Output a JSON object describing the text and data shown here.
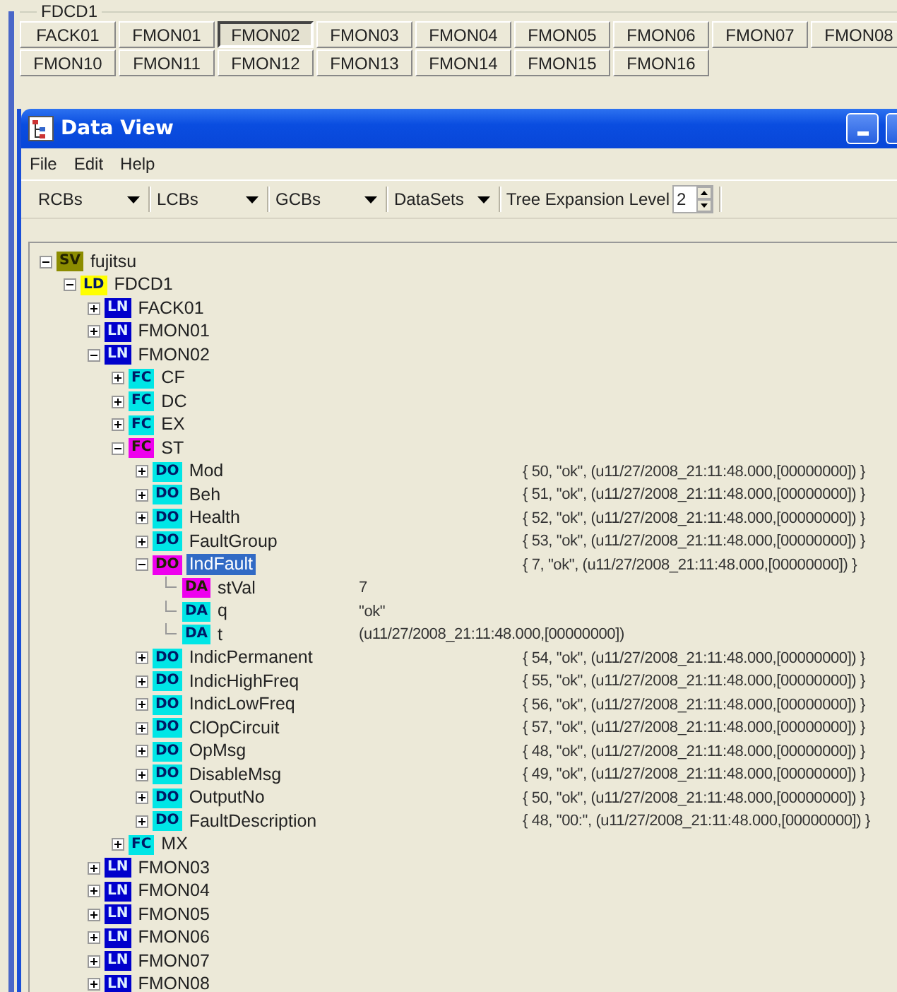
{
  "group": {
    "title": "FDCD1",
    "rows": [
      [
        {
          "label": "FACK01",
          "selected": false
        },
        {
          "label": "FMON01",
          "selected": false
        },
        {
          "label": "FMON02",
          "selected": true
        },
        {
          "label": "FMON03",
          "selected": false
        },
        {
          "label": "FMON04",
          "selected": false
        },
        {
          "label": "FMON05",
          "selected": false
        },
        {
          "label": "FMON06",
          "selected": false
        },
        {
          "label": "FMON07",
          "selected": false
        },
        {
          "label": "FMON08",
          "selected": false
        }
      ],
      [
        {
          "label": "FMON10",
          "selected": false
        },
        {
          "label": "FMON11",
          "selected": false
        },
        {
          "label": "FMON12",
          "selected": false
        },
        {
          "label": "FMON13",
          "selected": false
        },
        {
          "label": "FMON14",
          "selected": false
        },
        {
          "label": "FMON15",
          "selected": false
        },
        {
          "label": "FMON16",
          "selected": false
        }
      ]
    ]
  },
  "window": {
    "title": "Data View"
  },
  "menu": [
    "File",
    "Edit",
    "Help"
  ],
  "toolbar": {
    "dropdowns": [
      "RCBs",
      "LCBs",
      "GCBs",
      "DataSets"
    ],
    "level_label": "Tree Expansion Level",
    "level_value": "2"
  },
  "tree": [
    {
      "tag": "SV",
      "color": "#8c8c00",
      "label": "fujitsu",
      "expanded": true,
      "selected": false,
      "children": [
        {
          "tag": "LD",
          "color": "#ffff00",
          "label": "FDCD1",
          "expanded": true,
          "selected": false,
          "children": [
            {
              "tag": "LN",
              "color": "#0000cc",
              "label": "FACK01",
              "expanded": false,
              "selected": false
            },
            {
              "tag": "LN",
              "color": "#0000cc",
              "label": "FMON01",
              "expanded": false,
              "selected": false
            },
            {
              "tag": "LN",
              "color": "#0000cc",
              "label": "FMON02",
              "expanded": true,
              "selected": false,
              "children": [
                {
                  "tag": "FC",
                  "color": "#00e6e6",
                  "label": "CF",
                  "expanded": false,
                  "selected": false
                },
                {
                  "tag": "FC",
                  "color": "#00e6e6",
                  "label": "DC",
                  "expanded": false,
                  "selected": false
                },
                {
                  "tag": "FC",
                  "color": "#00e6e6",
                  "label": "EX",
                  "expanded": false,
                  "selected": false
                },
                {
                  "tag": "FC",
                  "color": "#ee00ee",
                  "label": "ST",
                  "expanded": true,
                  "selected": false,
                  "children": [
                    {
                      "tag": "DO",
                      "color": "#00e6e6",
                      "label": "Mod",
                      "expanded": false,
                      "selected": false,
                      "value": "{ 50, \"ok\", (u11/27/2008_21:11:48.000,[00000000]) }"
                    },
                    {
                      "tag": "DO",
                      "color": "#00e6e6",
                      "label": "Beh",
                      "expanded": false,
                      "selected": false,
                      "value": "{ 51, \"ok\", (u11/27/2008_21:11:48.000,[00000000]) }"
                    },
                    {
                      "tag": "DO",
                      "color": "#00e6e6",
                      "label": "Health",
                      "expanded": false,
                      "selected": false,
                      "value": "{ 52, \"ok\", (u11/27/2008_21:11:48.000,[00000000]) }"
                    },
                    {
                      "tag": "DO",
                      "color": "#00e6e6",
                      "label": "FaultGroup",
                      "expanded": false,
                      "selected": false,
                      "value": "{ 53, \"ok\", (u11/27/2008_21:11:48.000,[00000000]) }"
                    },
                    {
                      "tag": "DO",
                      "color": "#ee00ee",
                      "label": "IndFault",
                      "expanded": true,
                      "selected": true,
                      "value": "{ 7, \"ok\", (u11/27/2008_21:11:48.000,[00000000]) }",
                      "children": [
                        {
                          "tag": "DA",
                          "color": "#ee00ee",
                          "label": "stVal",
                          "selected": false,
                          "value": "7"
                        },
                        {
                          "tag": "DA",
                          "color": "#00e6e6",
                          "label": "q",
                          "selected": false,
                          "value": "\"ok\""
                        },
                        {
                          "tag": "DA",
                          "color": "#00e6e6",
                          "label": "t",
                          "selected": false,
                          "value": "(u11/27/2008_21:11:48.000,[00000000])"
                        }
                      ]
                    },
                    {
                      "tag": "DO",
                      "color": "#00e6e6",
                      "label": "IndicPermanent",
                      "expanded": false,
                      "selected": false,
                      "value": "{ 54, \"ok\", (u11/27/2008_21:11:48.000,[00000000]) }"
                    },
                    {
                      "tag": "DO",
                      "color": "#00e6e6",
                      "label": "IndicHighFreq",
                      "expanded": false,
                      "selected": false,
                      "value": "{ 55, \"ok\", (u11/27/2008_21:11:48.000,[00000000]) }"
                    },
                    {
                      "tag": "DO",
                      "color": "#00e6e6",
                      "label": "IndicLowFreq",
                      "expanded": false,
                      "selected": false,
                      "value": "{ 56, \"ok\", (u11/27/2008_21:11:48.000,[00000000]) }"
                    },
                    {
                      "tag": "DO",
                      "color": "#00e6e6",
                      "label": "ClOpCircuit",
                      "expanded": false,
                      "selected": false,
                      "value": "{ 57, \"ok\", (u11/27/2008_21:11:48.000,[00000000]) }"
                    },
                    {
                      "tag": "DO",
                      "color": "#00e6e6",
                      "label": "OpMsg",
                      "expanded": false,
                      "selected": false,
                      "value": "{ 48, \"ok\", (u11/27/2008_21:11:48.000,[00000000]) }"
                    },
                    {
                      "tag": "DO",
                      "color": "#00e6e6",
                      "label": "DisableMsg",
                      "expanded": false,
                      "selected": false,
                      "value": "{ 49, \"ok\", (u11/27/2008_21:11:48.000,[00000000]) }"
                    },
                    {
                      "tag": "DO",
                      "color": "#00e6e6",
                      "label": "OutputNo",
                      "expanded": false,
                      "selected": false,
                      "value": "{ 50, \"ok\", (u11/27/2008_21:11:48.000,[00000000]) }"
                    },
                    {
                      "tag": "DO",
                      "color": "#00e6e6",
                      "label": "FaultDescription",
                      "expanded": false,
                      "selected": false,
                      "value": "{ 48, \"00:\", (u11/27/2008_21:11:48.000,[00000000]) }"
                    }
                  ]
                },
                {
                  "tag": "FC",
                  "color": "#00e6e6",
                  "label": "MX",
                  "expanded": false,
                  "selected": false
                }
              ]
            },
            {
              "tag": "LN",
              "color": "#0000cc",
              "label": "FMON03",
              "expanded": false,
              "selected": false
            },
            {
              "tag": "LN",
              "color": "#0000cc",
              "label": "FMON04",
              "expanded": false,
              "selected": false
            },
            {
              "tag": "LN",
              "color": "#0000cc",
              "label": "FMON05",
              "expanded": false,
              "selected": false
            },
            {
              "tag": "LN",
              "color": "#0000cc",
              "label": "FMON06",
              "expanded": false,
              "selected": false
            },
            {
              "tag": "LN",
              "color": "#0000cc",
              "label": "FMON07",
              "expanded": false,
              "selected": false
            },
            {
              "tag": "LN",
              "color": "#0000cc",
              "label": "FMON08",
              "expanded": false,
              "selected": false
            }
          ]
        }
      ]
    }
  ]
}
